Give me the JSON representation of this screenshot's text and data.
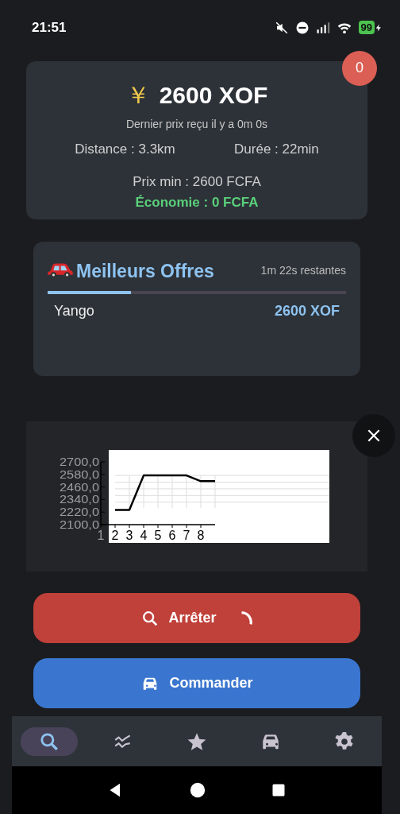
{
  "status_bar": {
    "time": "21:51",
    "battery": "99"
  },
  "price_card": {
    "currency_symbol": "￥",
    "price": "2600 XOF",
    "last_update": "Dernier prix reçu il y a 0m 0s",
    "distance": "Distance : 3.3km",
    "duration": "Durée : 22min",
    "min_price": "Prix min : 2600 FCFA",
    "savings": "Économie : 0 FCFA",
    "badge": "0"
  },
  "offers_card": {
    "title": "Meilleurs Offres",
    "remaining": "1m 22s restantes",
    "level": 0.28,
    "offers": [
      {
        "provider": "Yango",
        "price": "2600 XOF"
      }
    ]
  },
  "chart_panel": {
    "chart_data": {
      "type": "line",
      "x": [
        2,
        3,
        4,
        5,
        6,
        7,
        8,
        9
      ],
      "xlim": [
        1,
        9
      ],
      "series": [
        {
          "color": "#000000",
          "values": [
            2240,
            2240,
            2570,
            2570,
            2570,
            2570,
            2515,
            2515
          ]
        }
      ],
      "ylim": [
        2100,
        2700
      ],
      "yticks": [
        {
          "value": 2100,
          "label": "2100,0"
        },
        {
          "value": 2220,
          "label": "2220,0"
        },
        {
          "value": 2340,
          "label": "2340,0"
        },
        {
          "value": 2460,
          "label": "2460,0"
        },
        {
          "value": 2580,
          "label": "2580,0"
        },
        {
          "value": 2700,
          "label": "2700,0"
        }
      ],
      "xticks": [
        1,
        2,
        3,
        4,
        5,
        6,
        7,
        8
      ]
    }
  },
  "buttons": [
    {
      "kind": "stop",
      "label": "Arrêter",
      "loading": true
    },
    {
      "kind": "order",
      "label": "Commander",
      "loading": false
    }
  ],
  "bottom_nav": [
    {
      "kind": "search",
      "selected": true
    },
    {
      "kind": "trend",
      "selected": false
    },
    {
      "kind": "star",
      "selected": false
    },
    {
      "kind": "car",
      "selected": false
    },
    {
      "kind": "gear",
      "selected": false
    }
  ]
}
